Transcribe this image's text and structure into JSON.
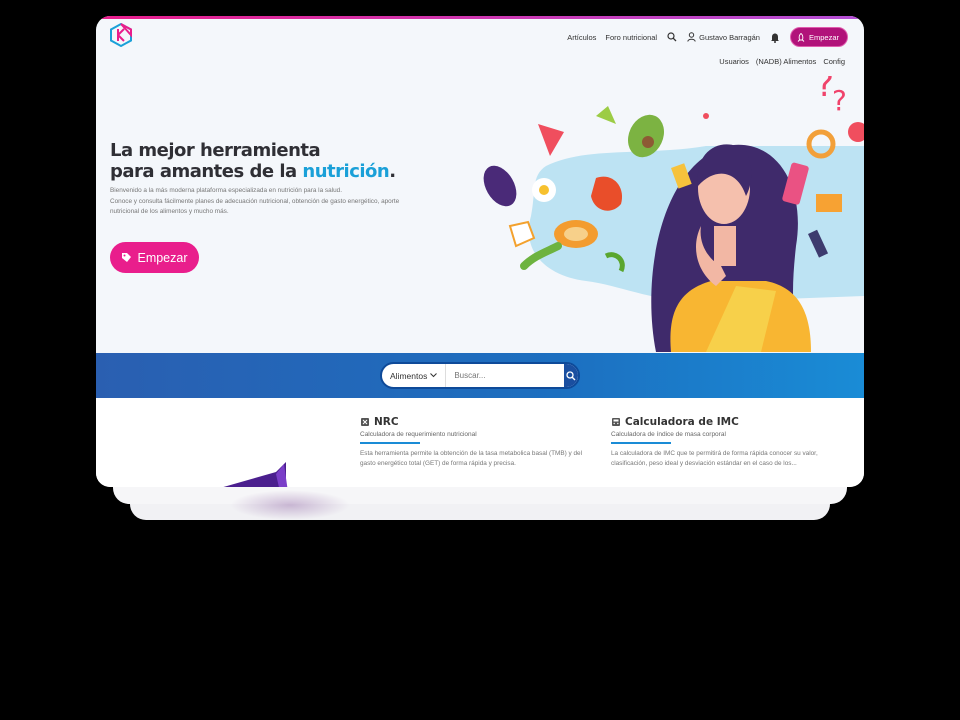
{
  "nav": {
    "articles": "Artículos",
    "forum": "Foro nutricional",
    "user_name": "Gustavo Barragán",
    "start_button": "Empezar",
    "sub_items": [
      "Usuarios",
      "(NADB) Alimentos",
      "Config"
    ]
  },
  "hero": {
    "title_line1": "La mejor herramienta",
    "title_line2_prefix": "para amantes de la ",
    "title_accent": "nutrición",
    "title_suffix": ".",
    "desc_line1": "Bienvenido a la más moderna plataforma especializada en nutrición para la salud.",
    "desc_line2": "Conoce y consulta fácilmente planes de adecuación nutricional, obtención de gasto energético, aporte",
    "desc_line3": "nutricional de los alimentos y mucho más.",
    "cta_label": "Empezar"
  },
  "search": {
    "category": "Alimentos",
    "placeholder": "Buscar..."
  },
  "tools": [
    {
      "title": "NRC",
      "subtitle": "Calculadora de requerimiento nutricional",
      "body": "Esta herramienta permite la obtención de la tasa metabolica basal (TMB) y del gasto energético total (GET) de forma rápida y precisa."
    },
    {
      "title": "Calculadora de IMC",
      "subtitle": "Calculadora de índice de masa corporal",
      "body": "La calculadora de IMC que te permitirá de forma rápida conocer su valor, clasificación, peso ideal y desviación estándar en el caso de los..."
    }
  ],
  "colors": {
    "accent_pink": "#e91e8c",
    "accent_blue": "#1aa0d8",
    "band_blue": "#1c6fc0"
  }
}
